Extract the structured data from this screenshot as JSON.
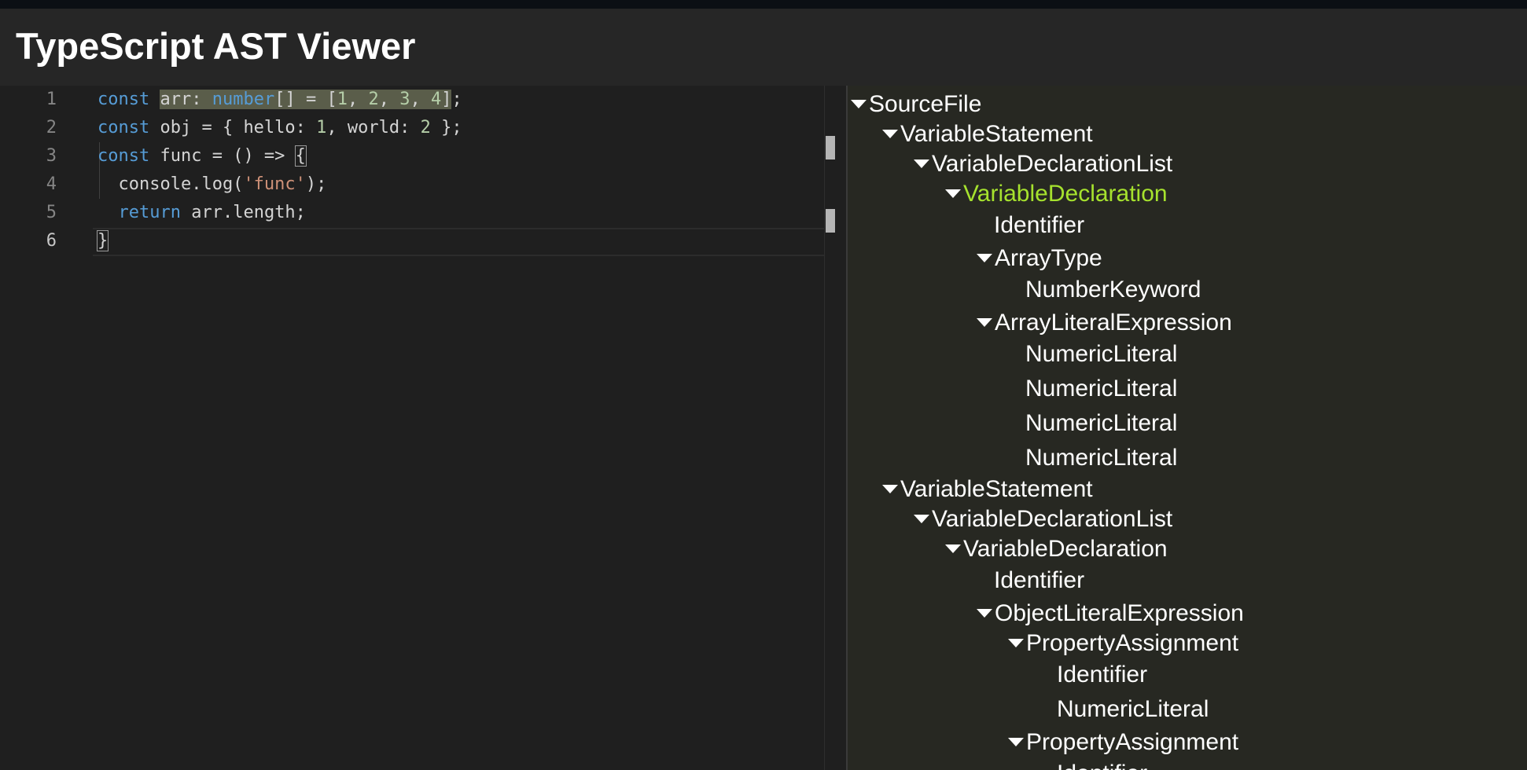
{
  "app": {
    "title": "TypeScript AST Viewer"
  },
  "editor": {
    "line_numbers": [
      "1",
      "2",
      "3",
      "4",
      "5",
      "6"
    ],
    "lines": [
      [
        {
          "t": "const",
          "c": "kw"
        },
        {
          "t": " ",
          "c": "ws"
        },
        {
          "t": "arr:",
          "c": "sel"
        },
        {
          "t": " ",
          "c": "sel ws"
        },
        {
          "t": "number",
          "c": "sel kw"
        },
        {
          "t": "[]",
          "c": "sel"
        },
        {
          "t": " ",
          "c": "sel ws"
        },
        {
          "t": "=",
          "c": "sel"
        },
        {
          "t": " ",
          "c": "sel ws"
        },
        {
          "t": "[",
          "c": "sel"
        },
        {
          "t": "1",
          "c": "sel num"
        },
        {
          "t": ",",
          "c": "sel"
        },
        {
          "t": " ",
          "c": "sel ws"
        },
        {
          "t": "2",
          "c": "sel num"
        },
        {
          "t": ",",
          "c": "sel"
        },
        {
          "t": " ",
          "c": "sel ws"
        },
        {
          "t": "3",
          "c": "sel num"
        },
        {
          "t": ",",
          "c": "sel"
        },
        {
          "t": " ",
          "c": "sel ws"
        },
        {
          "t": "4",
          "c": "sel num"
        },
        {
          "t": "]",
          "c": "sel"
        },
        {
          "t": ";",
          "c": ""
        }
      ],
      [
        {
          "t": "const",
          "c": "kw"
        },
        {
          "t": " obj = { hello: ",
          "c": ""
        },
        {
          "t": "1",
          "c": "num"
        },
        {
          "t": ", world: ",
          "c": ""
        },
        {
          "t": "2",
          "c": "num"
        },
        {
          "t": " };",
          "c": ""
        }
      ],
      [
        {
          "t": "const",
          "c": "kw"
        },
        {
          "t": " func = () => ",
          "c": ""
        },
        {
          "t": "{",
          "c": "cursor-box"
        }
      ],
      [
        {
          "t": "  console.log(",
          "c": ""
        },
        {
          "t": "'func'",
          "c": "str"
        },
        {
          "t": ");",
          "c": ""
        }
      ],
      [
        {
          "t": "  ",
          "c": ""
        },
        {
          "t": "return",
          "c": "kw"
        },
        {
          "t": " arr.length;",
          "c": ""
        }
      ],
      [
        {
          "t": "}",
          "c": "cursor-box"
        }
      ]
    ]
  },
  "tree": {
    "nodes": [
      {
        "label": "SourceFile",
        "depth": 0,
        "expanded": true
      },
      {
        "label": "VariableStatement",
        "depth": 1,
        "expanded": true
      },
      {
        "label": "VariableDeclarationList",
        "depth": 2,
        "expanded": true
      },
      {
        "label": "VariableDeclaration",
        "depth": 3,
        "expanded": true,
        "selected": true
      },
      {
        "label": "Identifier",
        "depth": 4,
        "expanded": false
      },
      {
        "label": "ArrayType",
        "depth": 4,
        "expanded": true
      },
      {
        "label": "NumberKeyword",
        "depth": 5,
        "expanded": false
      },
      {
        "label": "ArrayLiteralExpression",
        "depth": 4,
        "expanded": true
      },
      {
        "label": "NumericLiteral",
        "depth": 5,
        "expanded": false
      },
      {
        "label": "NumericLiteral",
        "depth": 5,
        "expanded": false
      },
      {
        "label": "NumericLiteral",
        "depth": 5,
        "expanded": false
      },
      {
        "label": "NumericLiteral",
        "depth": 5,
        "expanded": false
      },
      {
        "label": "VariableStatement",
        "depth": 1,
        "expanded": true
      },
      {
        "label": "VariableDeclarationList",
        "depth": 2,
        "expanded": true
      },
      {
        "label": "VariableDeclaration",
        "depth": 3,
        "expanded": true
      },
      {
        "label": "Identifier",
        "depth": 4,
        "expanded": false
      },
      {
        "label": "ObjectLiteralExpression",
        "depth": 4,
        "expanded": true
      },
      {
        "label": "PropertyAssignment",
        "depth": 5,
        "expanded": true
      },
      {
        "label": "Identifier",
        "depth": 6,
        "expanded": false
      },
      {
        "label": "NumericLiteral",
        "depth": 6,
        "expanded": false
      },
      {
        "label": "PropertyAssignment",
        "depth": 5,
        "expanded": true
      },
      {
        "label": "Identifier",
        "depth": 6,
        "expanded": false
      }
    ]
  },
  "colors": {
    "selected_node": "#a6e22e",
    "keyword": "#569cd6",
    "number": "#b5cea8",
    "string": "#ce9178"
  }
}
